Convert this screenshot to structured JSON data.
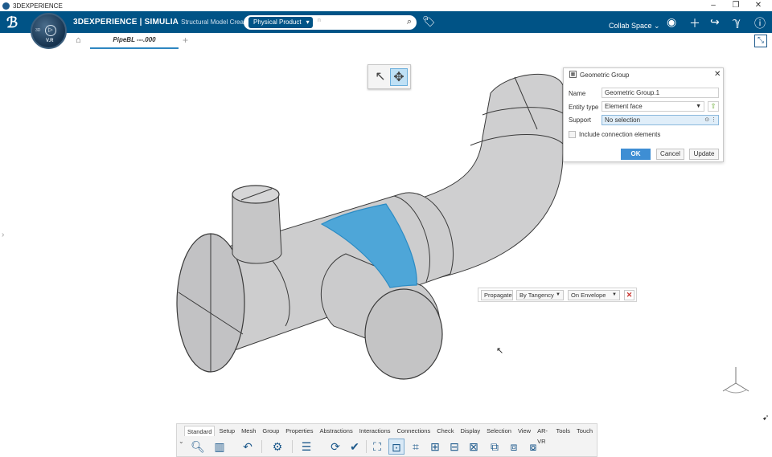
{
  "os": {
    "title": "3DEXPERIENCE",
    "controls": [
      "–",
      "❐",
      "✕"
    ]
  },
  "topbar": {
    "brand": "3DEXPERIENCE | SIMULIA",
    "app_name": "Structural Model Crea...",
    "search_scope": "Physical Product",
    "search_placeholder": "n",
    "collab_space": "Collab Space",
    "icons": [
      "tag-icon",
      "user-icon",
      "add-icon",
      "share-icon",
      "tools-icon",
      "help-icon"
    ],
    "accent": "#005386"
  },
  "compass": {
    "label": "3D",
    "version": "V.R",
    "play_glyph": "▷"
  },
  "tabs": {
    "active_label": "PipeBL ---.000",
    "add_label": "+"
  },
  "selection_toolbar": {
    "tools": [
      "select-arrow-icon",
      "select-move-icon"
    ],
    "active_index": 1
  },
  "dialog": {
    "title": "Geometric Group",
    "name_label": "Name",
    "name_value": "Geometric Group.1",
    "entity_type_label": "Entity type",
    "entity_type_value": "Element face",
    "support_label": "Support",
    "support_value": "No selection",
    "include_label": "Include connection elements",
    "include_checked": false,
    "ok_label": "OK",
    "cancel_label": "Cancel",
    "update_label": "Update",
    "ok_color": "#3e8ed4"
  },
  "propagate": {
    "propagate_label": "Propagate",
    "mode_value": "By Tangency",
    "scope_value": "On Envelope",
    "close_color": "#c8332d"
  },
  "model": {
    "selected_face_color": "#4ea6d8",
    "body_color": "#cfcfd0"
  },
  "action_bar": {
    "tabs": [
      "Standard",
      "Setup",
      "Mesh",
      "Group",
      "Properties",
      "Abstractions",
      "Interactions",
      "Connections",
      "Check",
      "Display",
      "Selection",
      "View",
      "AR-VR",
      "Tools",
      "Touch"
    ],
    "active_tab": "Standard",
    "icons": [
      "zoom-icon",
      "book-icon",
      "undo-icon",
      "group-tool-icon",
      "table-icon",
      "refresh-icon",
      "check-icon",
      "fit-all-icon",
      "select-group-icon",
      "frame-icon",
      "frame-select-icon",
      "frame-move-icon",
      "frame-mesh-icon",
      "group-edit-icon",
      "group-face-icon",
      "group-node-icon"
    ]
  }
}
